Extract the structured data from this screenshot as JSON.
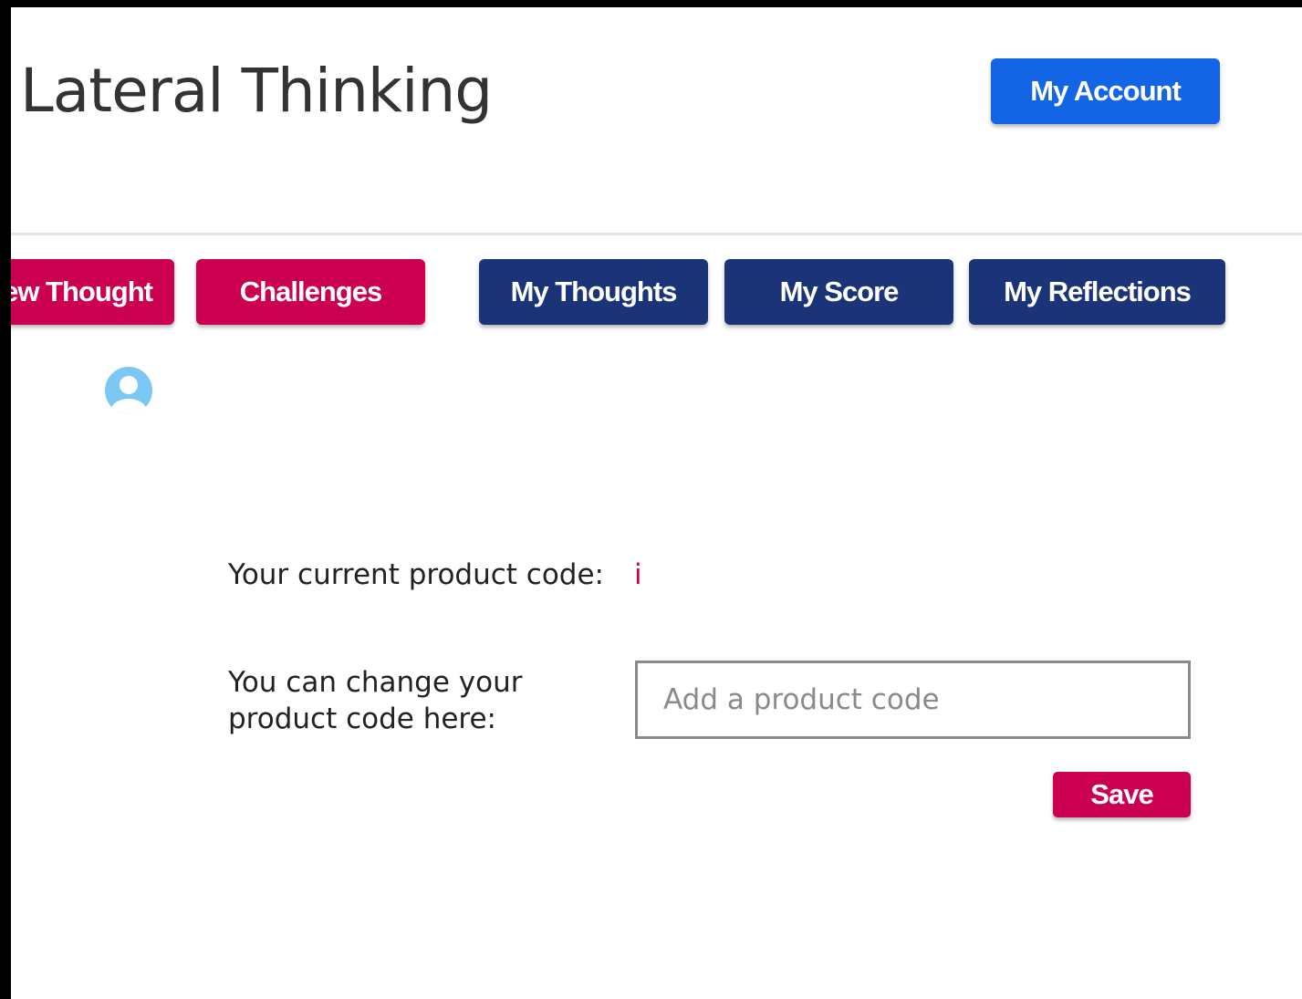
{
  "header": {
    "title": "Lateral Thinking",
    "account_label": "My Account"
  },
  "nav": {
    "items": [
      {
        "label": "New Thought"
      },
      {
        "label": "Challenges"
      },
      {
        "label": "My Thoughts"
      },
      {
        "label": "My Score"
      },
      {
        "label": "My Reflections"
      }
    ]
  },
  "profile": {
    "avatar_icon": "user-circle-icon"
  },
  "product_code": {
    "current_label": "Your current product code:",
    "current_value": "i",
    "change_label": "You can change your product code here:",
    "input_value": "",
    "input_placeholder": "Add a product code",
    "save_label": "Save"
  },
  "colors": {
    "primary_blue": "#1464e6",
    "nav_red": "#cc0050",
    "nav_navy": "#1b3478",
    "avatar_blue": "#7cc8f4"
  }
}
